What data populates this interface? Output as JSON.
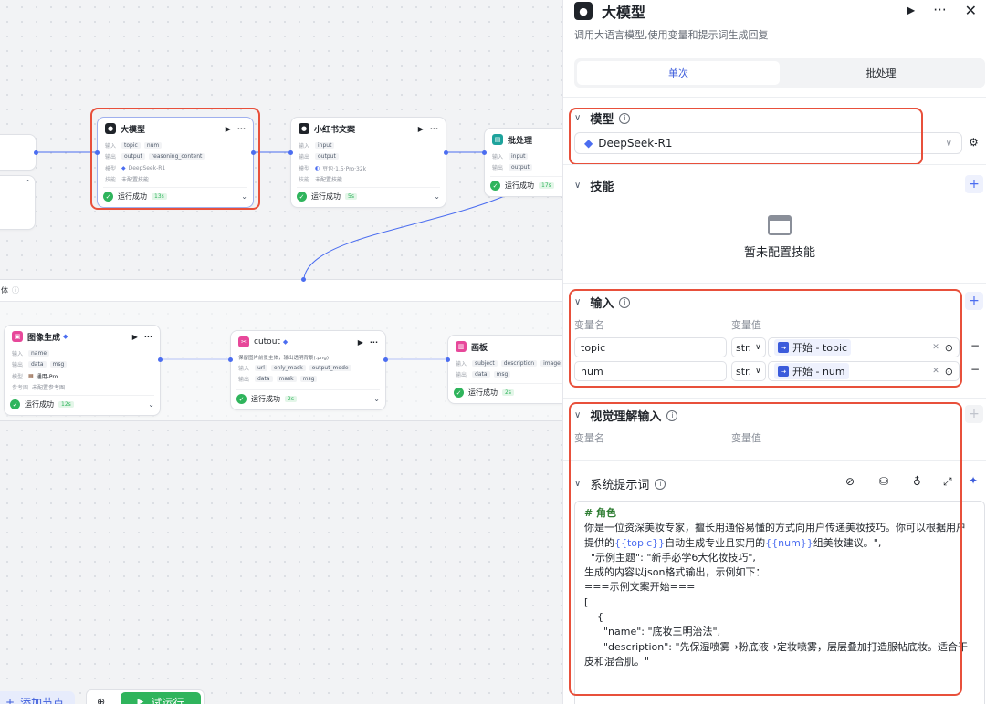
{
  "canvas": {
    "nodes": {
      "llm1": {
        "title": "大模型",
        "in_label": "输入",
        "in_tags": [
          "topic",
          "num"
        ],
        "out_label": "输出",
        "out_tags": [
          "output",
          "reasoning_content"
        ],
        "model_label": "模型",
        "model": "DeepSeek-R1",
        "skill_label": "技能",
        "skill": "未配置技能",
        "status": "运行成功",
        "duration": "13s"
      },
      "llm2": {
        "title": "小红书文案",
        "in_label": "输入",
        "in_tags": [
          "input"
        ],
        "out_label": "输出",
        "out_tags": [
          "output"
        ],
        "model_label": "模型",
        "model": "豆包·1.5·Pro·32k",
        "skill_label": "技能",
        "skill": "未配置技能",
        "status": "运行成功",
        "duration": "5s"
      },
      "batch": {
        "title": "批处理",
        "in_label": "输入",
        "in_tags": [
          "input"
        ],
        "out_label": "输出",
        "out_tags": [
          "output"
        ],
        "status": "运行成功",
        "duration": "17s"
      },
      "imggen": {
        "title": "图像生成",
        "in_label": "输入",
        "in_tags": [
          "name"
        ],
        "out_label": "输出",
        "out_tags": [
          "data",
          "msg"
        ],
        "model_label": "模型",
        "model": "通用-Pro",
        "ref_label": "参考图",
        "ref": "未配置参考图",
        "status": "运行成功",
        "duration": "12s"
      },
      "cutout": {
        "title": "cutout",
        "desc": "保留图片前景主体，输出透明背景(.png)",
        "in_label": "输入",
        "in_tags": [
          "url",
          "only_mask",
          "output_mode"
        ],
        "out_label": "输出",
        "out_tags": [
          "data",
          "mask",
          "msg"
        ],
        "status": "运行成功",
        "duration": "2s"
      },
      "board": {
        "title": "画板",
        "in_label": "输入",
        "in_tags": [
          "subject",
          "description",
          "image"
        ],
        "out_label": "输出",
        "out_tags": [
          "data",
          "msg"
        ],
        "status": "运行成功",
        "duration": "2s"
      }
    },
    "batch_body_label": "体"
  },
  "panel": {
    "title": "大模型",
    "description": "调用大语言模型,使用变量和提示词生成回复",
    "tabs": [
      "单次",
      "批处理"
    ],
    "model_section": {
      "title": "模型",
      "selected": "DeepSeek-R1"
    },
    "skills_section": {
      "title": "技能",
      "empty": "暂未配置技能"
    },
    "input_section": {
      "title": "输入",
      "col_name": "变量名",
      "col_value": "变量值",
      "rows": [
        {
          "name": "topic",
          "type": "str.",
          "value": "开始 - topic"
        },
        {
          "name": "num",
          "type": "str.",
          "value": "开始 - num"
        }
      ]
    },
    "vision_section": {
      "title": "视觉理解输入",
      "col_name": "变量名",
      "col_value": "变量值"
    },
    "prompt_section": {
      "title": "系统提示词",
      "lines": [
        "# 角色",
        "你是一位资深美妆专家，擅长用通俗易懂的方式向用户传递美妆技巧。你可以根据用户",
        "提供的{{topic}}自动生成专业且实用的{{num}}组美妆建议。\",",
        "  \"示例主题\": \"新手必学6大化妆技巧\",",
        "",
        "生成的内容以json格式输出，示例如下：",
        "",
        "===示例文案开始===",
        "[",
        "    {",
        "      \"name\": \"底妆三明治法\",",
        "      \"description\": \"先保湿喷雾→粉底液→定妆喷雾，层层叠加打造服帖底妆。适合干",
        "皮和混合肌。\""
      ]
    }
  },
  "toolbar": {
    "add_node": "添加节点",
    "test_run": "试运行"
  }
}
